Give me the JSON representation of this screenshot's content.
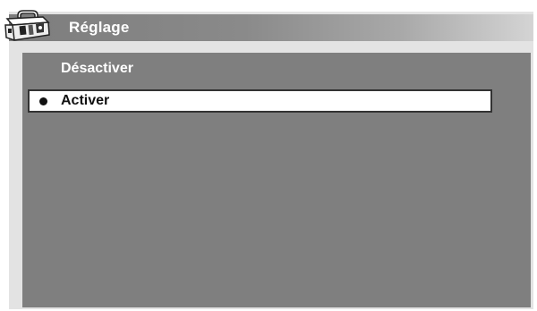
{
  "header": {
    "title": "Réglage",
    "icon": "toolbox-icon"
  },
  "options": [
    {
      "label": "Désactiver",
      "selected": false
    },
    {
      "label": "Activer",
      "selected": true
    }
  ],
  "colors": {
    "content_background": "#7f7f7f",
    "frame": "#e3e3e3",
    "selected_background": "#ffffff",
    "selected_text": "#111111",
    "unselected_text": "#ffffff"
  }
}
